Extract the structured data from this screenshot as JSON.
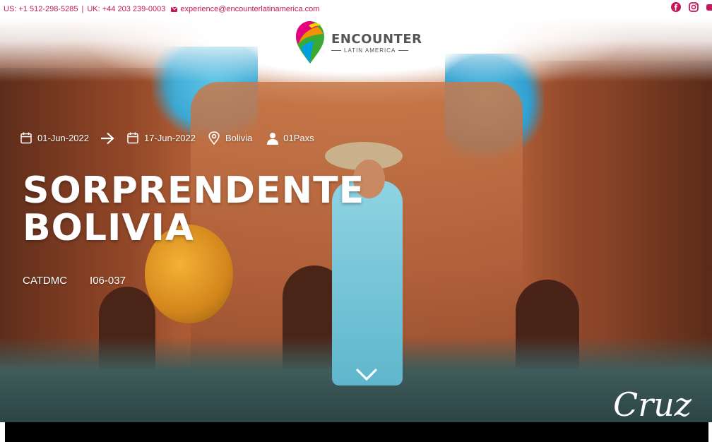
{
  "topbar": {
    "phone_us": "US: +1 512-298-5285",
    "separator": "|",
    "phone_uk": "UK: +44 203 239-0003",
    "email": "experience@encounterlatinamerica.com",
    "social_icons": [
      "facebook-icon",
      "instagram-icon",
      "youtube-icon"
    ]
  },
  "logo": {
    "main": "ENCOUNTER",
    "sub": "LATIN AMERICA"
  },
  "tour": {
    "start_date": "01-Jun-2022",
    "end_date": "17-Jun-2022",
    "country": "Bolivia",
    "pax": "01Paxs",
    "title_line1": "SORPRENDENTE",
    "title_line2": "BOLIVIA",
    "agency_code": "CATDMC",
    "tour_code": "I06-037"
  },
  "hero_script": "Cruz",
  "colors": {
    "accent": "#c2185b",
    "hero_text": "#ffffff"
  }
}
